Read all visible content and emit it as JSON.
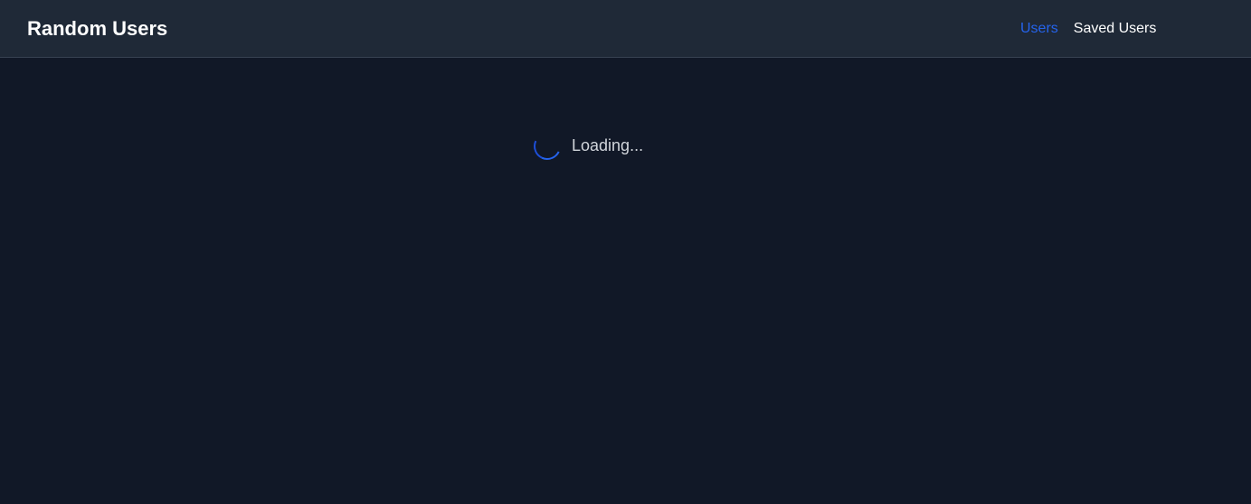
{
  "header": {
    "title": "Random Users",
    "nav": {
      "items": [
        {
          "label": "Users",
          "active": true
        },
        {
          "label": "Saved Users",
          "active": false
        }
      ]
    }
  },
  "main": {
    "loading_text": "Loading...",
    "spinner_icon": "spinner-icon"
  },
  "colors": {
    "background": "#111827",
    "header_background": "#1f2937",
    "accent": "#2563eb",
    "text_primary": "#ffffff",
    "text_muted": "#d1d5db"
  }
}
